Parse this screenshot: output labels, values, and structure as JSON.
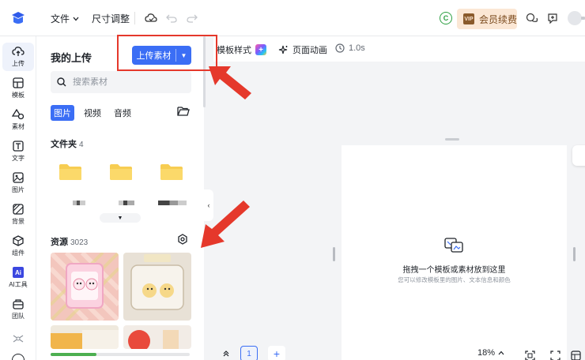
{
  "topbar": {
    "file_menu": "文件",
    "size_menu": "尺寸调整",
    "coin_letter": "C",
    "vip_badge": "VIP",
    "vip_label": "会员续费"
  },
  "rail": {
    "items": [
      {
        "label": "上传",
        "icon": "upload-icon"
      },
      {
        "label": "模板",
        "icon": "template-icon"
      },
      {
        "label": "素材",
        "icon": "shapes-icon"
      },
      {
        "label": "文字",
        "icon": "text-icon"
      },
      {
        "label": "图片",
        "icon": "image-icon"
      },
      {
        "label": "背景",
        "icon": "background-icon"
      },
      {
        "label": "组件",
        "icon": "component-icon"
      },
      {
        "label": "AI工具",
        "icon": "ai-tool-icon"
      },
      {
        "label": "团队",
        "icon": "team-icon"
      }
    ],
    "ai_badge": "Ai"
  },
  "panel": {
    "title": "我的上传",
    "upload_label": "上传素材",
    "search_placeholder": "搜索素材",
    "tabs": [
      "图片",
      "视频",
      "音频"
    ],
    "folders_title": "文件夹",
    "folders_count": "4",
    "resources_title": "资源",
    "resources_count": "3023",
    "progress": 0.33
  },
  "toolbar": {
    "template_style": "模板样式",
    "page_animation": "页面动画",
    "duration": "1.0s"
  },
  "canvas": {
    "empty_title": "拖拽一个模板或素材放到这里",
    "empty_subtitle": "您可以修改模板里的图片、文本信息和颜色"
  },
  "bottombar": {
    "page_number": "1",
    "add_page": "+",
    "zoom": "18%"
  },
  "colors": {
    "accent": "#3b6ef5",
    "annotation": "#e5382b",
    "vip_bg": "#fbe7d5"
  }
}
